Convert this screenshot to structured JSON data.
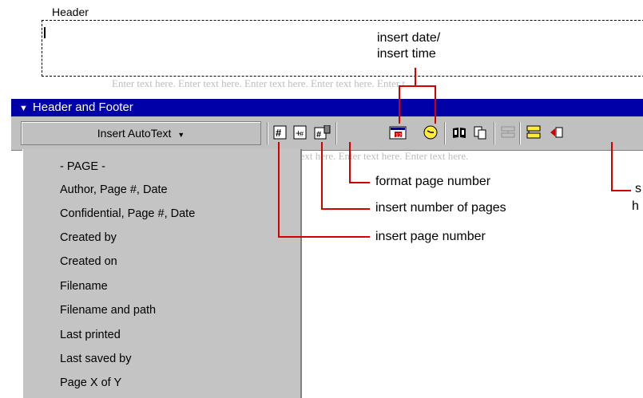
{
  "header": {
    "label": "Header",
    "background_text": "Enter text here.  Enter text here.  Enter text here.  Enter text here.  Enter t",
    "background_text_2": "text here.  Enter text here.  Enter text here."
  },
  "toolbar": {
    "title": "Header and Footer",
    "insert_autotext_label": "Insert AutoText",
    "title_bg_color": "#0000a8",
    "face_color": "#c0c0c0",
    "icons": [
      "insert-page-number-icon",
      "insert-number-of-pages-icon",
      "format-page-number-icon",
      "insert-date-icon",
      "insert-time-icon",
      "page-setup-icon",
      "show-hide-document-text-icon",
      "same-as-previous-icon",
      "switch-header-footer-icon",
      "show-previous-icon"
    ]
  },
  "autotext_menu": {
    "items": [
      {
        "label": "- PAGE -"
      },
      {
        "label": "Author, Page #, Date"
      },
      {
        "label": "Confidential, Page #, Date"
      },
      {
        "label": "Created by"
      },
      {
        "label": "Created on"
      },
      {
        "label": "Filename"
      },
      {
        "label": "Filename and path"
      },
      {
        "label": "Last printed"
      },
      {
        "label": "Last saved by"
      },
      {
        "label": "Page X of Y"
      }
    ]
  },
  "callouts": {
    "insert_date_time_1": "insert date/",
    "insert_date_time_2": "insert time",
    "format_page_number": "format page number",
    "insert_number_of_pages": "insert number of pages",
    "insert_page_number": "insert page number",
    "switch_partial_1": "s",
    "switch_partial_2": "h",
    "line_color": "#d40000"
  }
}
